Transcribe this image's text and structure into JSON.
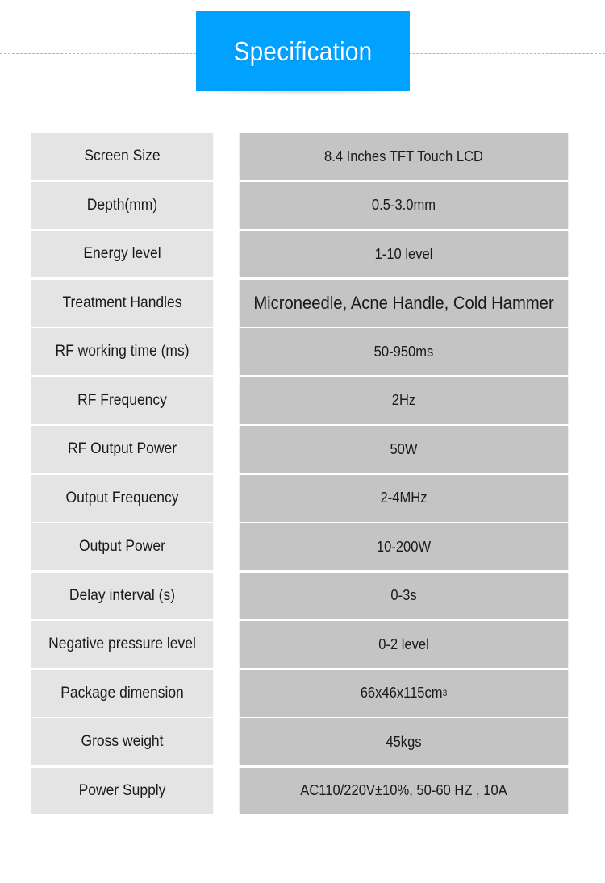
{
  "header": {
    "title": "Specification",
    "banner_color": "#00a1ff",
    "title_color": "#ffffff",
    "divider_style": "dashed"
  },
  "table": {
    "label_column_color": "#e4e4e4",
    "value_column_color": "#c4c4c4",
    "text_color": "#1a1a1a",
    "rows": [
      {
        "label": "Screen Size",
        "value": "8.4 Inches TFT Touch LCD"
      },
      {
        "label": "Depth(mm)",
        "value": "0.5-3.0mm"
      },
      {
        "label": "Energy level",
        "value": "1-10 level"
      },
      {
        "label": "Treatment Handles",
        "value": "Microneedle,  Acne Handle, Cold Hammer"
      },
      {
        "label": "RF working time (ms)",
        "value": "50-950ms"
      },
      {
        "label": "RF Frequency",
        "value": "2Hz"
      },
      {
        "label": "RF Output Power",
        "value": "50W"
      },
      {
        "label": "Output Frequency",
        "value": "2-4MHz"
      },
      {
        "label": "Output Power",
        "value": "10-200W"
      },
      {
        "label": "Delay interval (s)",
        "value": "0-3s"
      },
      {
        "label": "Negative pressure level",
        "value": "0-2 level"
      },
      {
        "label": "Package dimension",
        "value": "66x46x115cm",
        "value_sup": "3"
      },
      {
        "label": "Gross weight",
        "value": "45kgs"
      },
      {
        "label": "Power Supply",
        "value": "AC110/220V±10%, 50-60 HZ , 10A"
      }
    ]
  }
}
